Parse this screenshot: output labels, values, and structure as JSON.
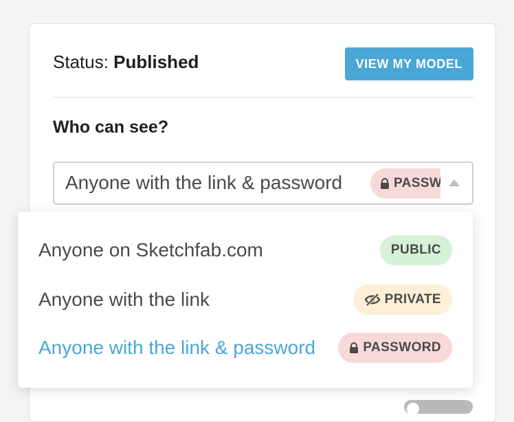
{
  "status": {
    "prefix": "Status:",
    "value": "Published",
    "view_button_label": "VIEW MY MODEL"
  },
  "visibility": {
    "label": "Who can see?",
    "selected_value": "Anyone with the link & password",
    "selected_badge": "PASSW",
    "options": [
      {
        "label": "Anyone on Sketchfab.com",
        "badge": "PUBLIC",
        "badge_icon": "none"
      },
      {
        "label": "Anyone with the link",
        "badge": "PRIVATE",
        "badge_icon": "eye-slash-icon"
      },
      {
        "label": "Anyone with the link & password",
        "badge": "PASSWORD",
        "badge_icon": "lock-icon",
        "selected": true
      }
    ]
  },
  "colors": {
    "accent": "#4aa6d6",
    "public_badge_bg": "#d6f2d6",
    "private_badge_bg": "#fdefd8",
    "password_badge_bg": "#f8d9da"
  }
}
